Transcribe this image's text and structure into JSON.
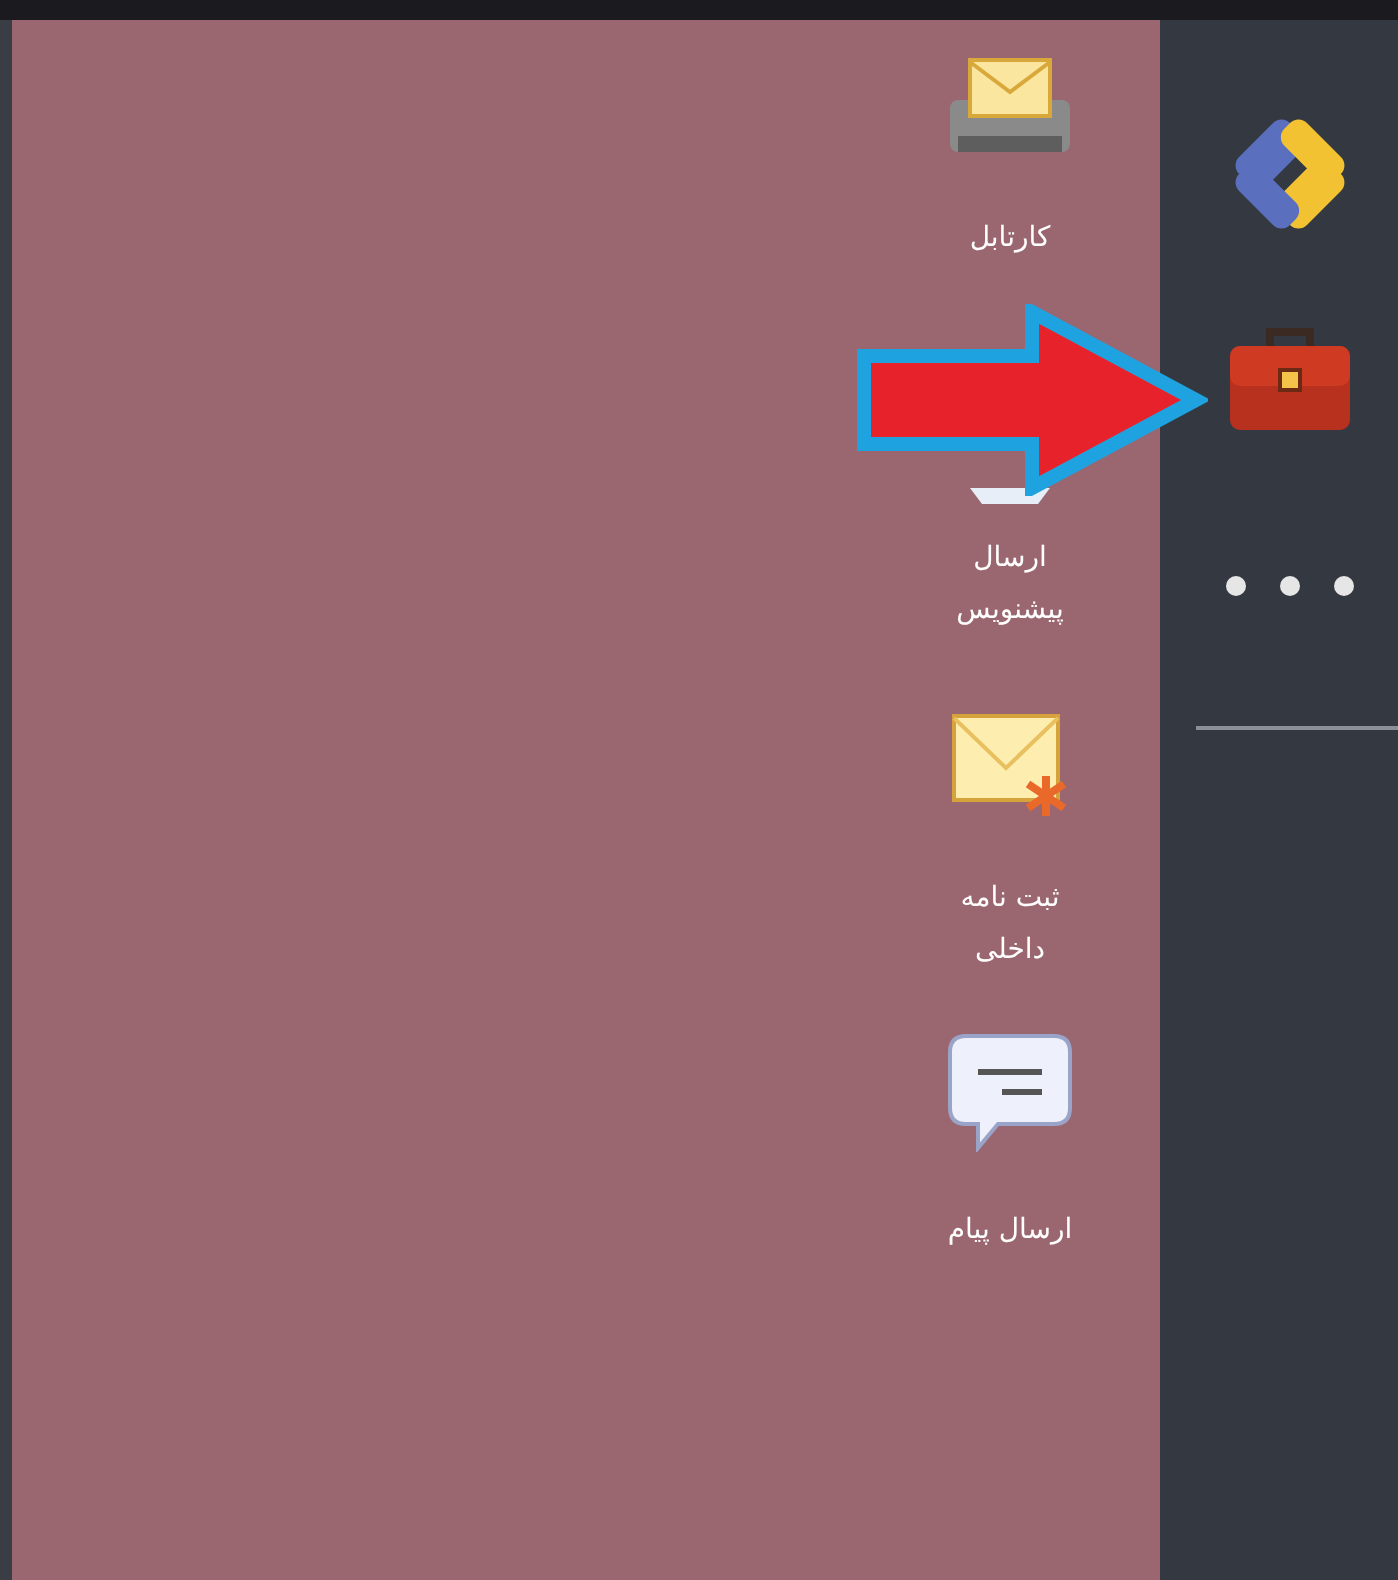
{
  "shortcuts": [
    {
      "kind": "tray",
      "label": "کارتابل"
    },
    {
      "kind": "draft",
      "label": "ارسال\nپیشنویس"
    },
    {
      "kind": "new-letter",
      "label": "ثبت نامه\nداخلی"
    },
    {
      "kind": "message",
      "label": "ارسال پیام"
    }
  ],
  "sidebar": {
    "items": [
      {
        "kind": "logo"
      },
      {
        "kind": "briefcase"
      },
      {
        "kind": "more"
      }
    ]
  }
}
